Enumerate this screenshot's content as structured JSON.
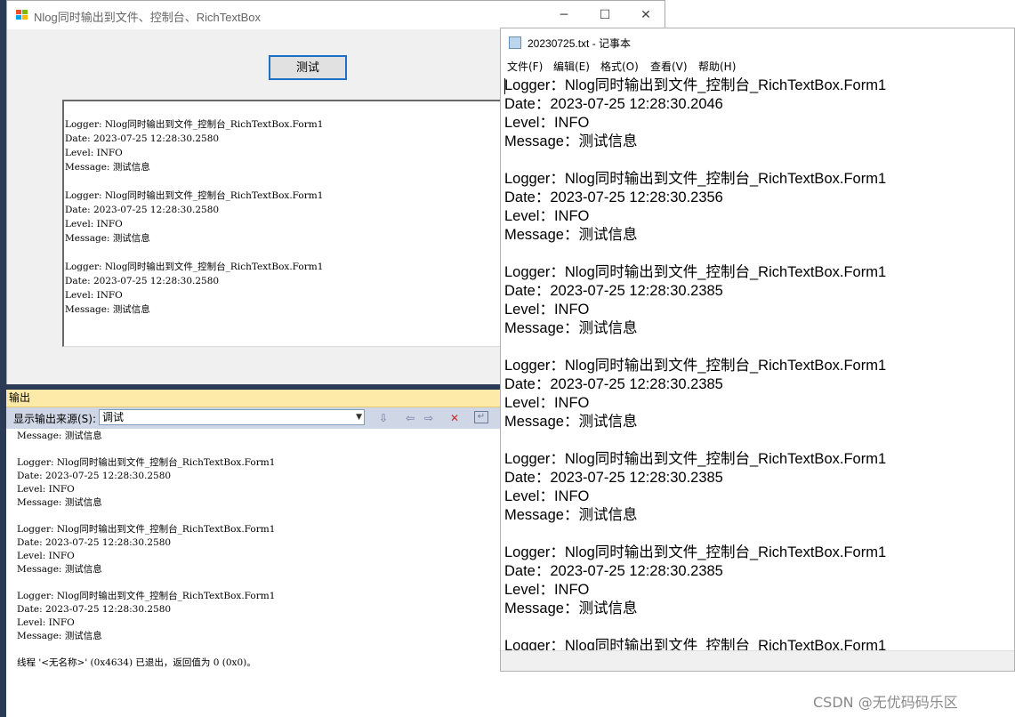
{
  "form": {
    "title": "Nlog同时输出到文件、控制台、RichTextBox",
    "minimize": "─",
    "maximize": "☐",
    "close": "✕",
    "test_button": "测试",
    "rtb_entries": [
      {
        "logger": "Logger: Nlog同时输出到文件_控制台_RichTextBox.Form1",
        "date": "Date: 2023-07-25 12:28:30.2580",
        "level": "Level: INFO",
        "message": "Message: 测试信息"
      },
      {
        "logger": "Logger: Nlog同时输出到文件_控制台_RichTextBox.Form1",
        "date": "Date: 2023-07-25 12:28:30.2580",
        "level": "Level: INFO",
        "message": "Message: 测试信息"
      },
      {
        "logger": "Logger: Nlog同时输出到文件_控制台_RichTextBox.Form1",
        "date": "Date: 2023-07-25 12:28:30.2580",
        "level": "Level: INFO",
        "message": "Message: 测试信息"
      }
    ]
  },
  "output": {
    "header": "输出",
    "source_label": "显示输出来源(S):",
    "source_value": "调试",
    "first_line": "Message: 测试信息",
    "entries": [
      {
        "logger": "Logger: Nlog同时输出到文件_控制台_RichTextBox.Form1",
        "date": "Date: 2023-07-25 12:28:30.2580",
        "level": "Level: INFO",
        "message": "Message: 测试信息"
      },
      {
        "logger": "Logger: Nlog同时输出到文件_控制台_RichTextBox.Form1",
        "date": "Date: 2023-07-25 12:28:30.2580",
        "level": "Level: INFO",
        "message": "Message: 测试信息"
      },
      {
        "logger": "Logger: Nlog同时输出到文件_控制台_RichTextBox.Form1",
        "date": "Date: 2023-07-25 12:28:30.2580",
        "level": "Level: INFO",
        "message": "Message: 测试信息"
      }
    ],
    "thread_exit": "线程 '<无名称>' (0x4634) 已退出，返回值为 0 (0x0)。"
  },
  "notepad": {
    "title": "20230725.txt - 记事本",
    "menu": [
      "文件(F)",
      "编辑(E)",
      "格式(O)",
      "查看(V)",
      "帮助(H)"
    ],
    "entries": [
      {
        "logger": "Logger：Nlog同时输出到文件_控制台_RichTextBox.Form1",
        "date": "Date：2023-07-25 12:28:30.2046",
        "level": "Level：INFO",
        "message": "Message：测试信息"
      },
      {
        "logger": "Logger：Nlog同时输出到文件_控制台_RichTextBox.Form1",
        "date": "Date：2023-07-25 12:28:30.2356",
        "level": "Level：INFO",
        "message": "Message：测试信息"
      },
      {
        "logger": "Logger：Nlog同时输出到文件_控制台_RichTextBox.Form1",
        "date": "Date：2023-07-25 12:28:30.2385",
        "level": "Level：INFO",
        "message": "Message：测试信息"
      },
      {
        "logger": "Logger：Nlog同时输出到文件_控制台_RichTextBox.Form1",
        "date": "Date：2023-07-25 12:28:30.2385",
        "level": "Level：INFO",
        "message": "Message：测试信息"
      },
      {
        "logger": "Logger：Nlog同时输出到文件_控制台_RichTextBox.Form1",
        "date": "Date：2023-07-25 12:28:30.2385",
        "level": "Level：INFO",
        "message": "Message：测试信息"
      },
      {
        "logger": "Logger：Nlog同时输出到文件_控制台_RichTextBox.Form1",
        "date": "Date：2023-07-25 12:28:30.2385",
        "level": "Level：INFO",
        "message": "Message：测试信息"
      }
    ],
    "last_line": "Logger：Nlog同时输出到文件_控制台_RichTextBox.Form1"
  },
  "watermark": "CSDN @无优码码乐区"
}
